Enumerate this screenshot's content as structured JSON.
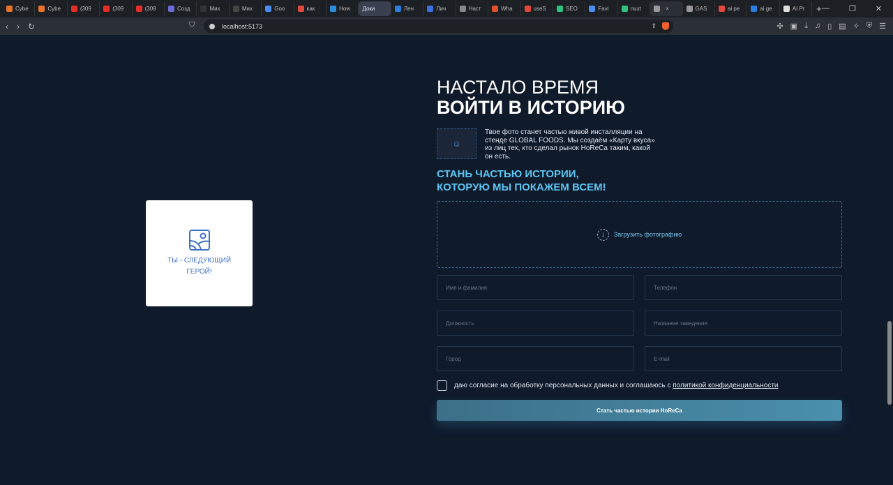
{
  "browser": {
    "tabs": [
      {
        "label": "Cybe",
        "color": "#e8742a"
      },
      {
        "label": "Cybe",
        "color": "#e8742a"
      },
      {
        "label": "(309",
        "color": "#e52d27"
      },
      {
        "label": "(309",
        "color": "#e52d27"
      },
      {
        "label": "(309",
        "color": "#e52d27"
      },
      {
        "label": "Созд",
        "color": "#6b6bd8"
      },
      {
        "label": "Мих",
        "color": "#333"
      },
      {
        "label": "Мих",
        "color": "#444"
      },
      {
        "label": "Goo",
        "color": "#4a8cf0"
      },
      {
        "label": "как",
        "color": "#e0483b"
      },
      {
        "label": "How",
        "color": "#2a8ee0"
      },
      {
        "label": "Доки",
        "color": "#3a4050"
      },
      {
        "label": "Лен",
        "color": "#2a7ee0"
      },
      {
        "label": "Лич",
        "color": "#3a70e0"
      },
      {
        "label": "Наст",
        "color": "#888"
      },
      {
        "label": "Wha",
        "color": "#e0502a"
      },
      {
        "label": "useS",
        "color": "#e0483b"
      },
      {
        "label": "SEO",
        "color": "#2ec27e"
      },
      {
        "label": "Favi",
        "color": "#4a8cf0"
      },
      {
        "label": "nuxt",
        "color": "#2ec27e"
      },
      {
        "label": "",
        "color": "#999"
      },
      {
        "label": "GAS",
        "color": "#999"
      },
      {
        "label": "ai pe",
        "color": "#e0483b"
      },
      {
        "label": "ai ge",
        "color": "#2a7ee0"
      },
      {
        "label": "AI Pr",
        "color": "#ddd"
      }
    ],
    "url": "localhost:5173"
  },
  "card": {
    "label": "ТЫ - СЛЕДУЮЩИЙ ГЕРОЙ!"
  },
  "hero": {
    "title_line1": "НАСТАЛО ВРЕМЯ",
    "title_line2": "ВОЙТИ В ИСТОРИЮ",
    "intro": "Твое фото станет частью живой инсталляции на стенде GLOBAL FOODS. Мы создаём «Карту вкуса» из лиц тех, кто сделал рынок HoReCa таким, какой он есть.",
    "subtitle_line1": "СТАНЬ ЧАСТЬЮ ИСТОРИИ,",
    "subtitle_line2": "КОТОРУЮ МЫ ПОКАЖЕМ ВСЕМ!"
  },
  "form": {
    "upload_label": "Загрузить фотографию",
    "fields": {
      "name": "Имя и фамилия",
      "phone": "Телефон",
      "position": "Должность",
      "venue": "Название заведения",
      "city": "Город",
      "email": "E-mail"
    },
    "consent_text": "даю согласие на обработку персональных данных и соглашаюсь с",
    "consent_link": "политикой конфиденциальности",
    "submit": "Стать частью истории HoReCa"
  }
}
